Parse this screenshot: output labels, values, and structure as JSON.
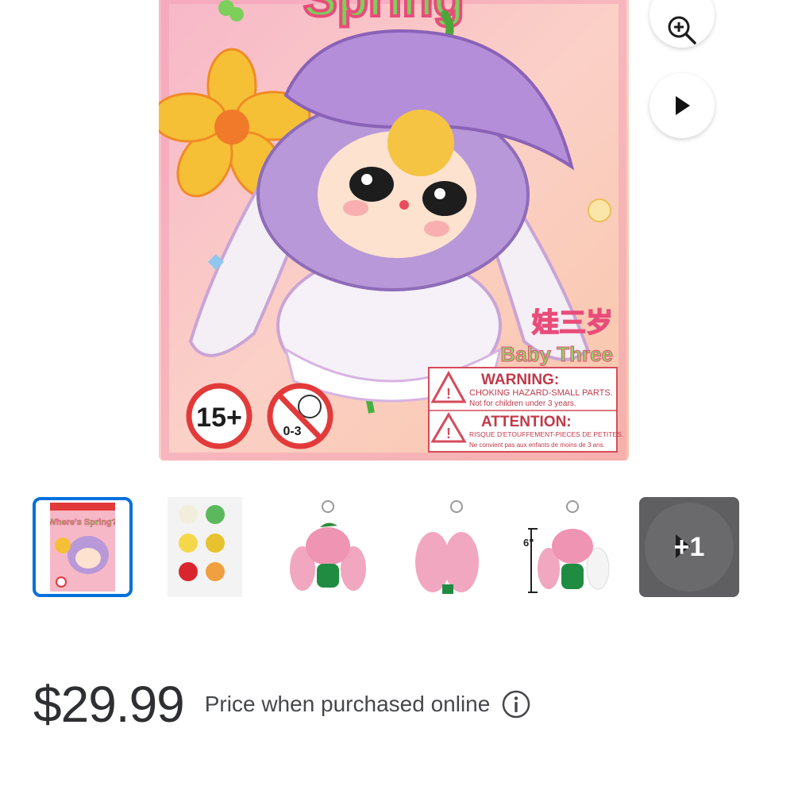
{
  "hero": {
    "banner_text": "Spring",
    "brand_cn": "娃三岁",
    "brand_en": "Baby Three",
    "age_badge": "15+",
    "age_forbidden": "0-3",
    "warning_title": "WARNING:",
    "warning_line1": "CHOKING HAZARD-SMALL PARTS.",
    "warning_line2": "Not for children under 3 years.",
    "attention_title": "ATTENTION:",
    "attention_line1": "RISQUE D'ETOUFFEMENT-PIECES DE PETITES.",
    "attention_line2": "Ne convient pas aux enfants de moins de 3 ans."
  },
  "controls": {
    "zoom_icon": "zoom-in-icon",
    "play_icon": "play-icon"
  },
  "thumbnails": {
    "box_title": "Where's Spring?",
    "size_label": "6\"",
    "more_label": "+1"
  },
  "price": {
    "amount": "$29.99",
    "note": "Price when purchased online"
  },
  "colors": {
    "selected_border": "#0071dc",
    "more_tile": "#5f5f62"
  }
}
